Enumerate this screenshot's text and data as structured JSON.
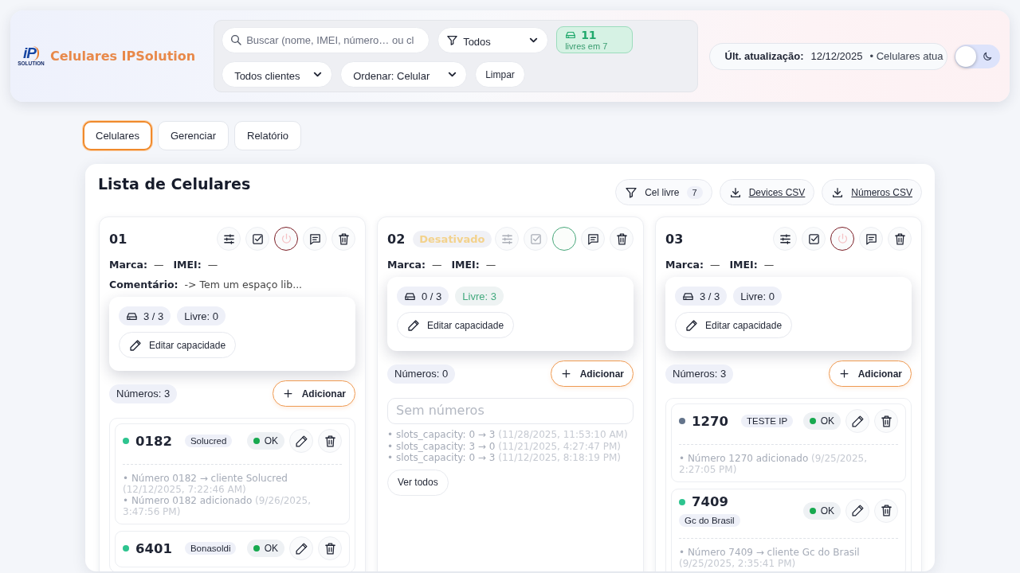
{
  "header": {
    "logo": {
      "mark": "iP",
      "caption": "SOLUTION"
    },
    "brand": "Celulares IPSolution",
    "search": {
      "placeholder": "Buscar (nome, IMEI, número… ou cl"
    },
    "status_select": {
      "value": "Todos"
    },
    "free_badge": {
      "count": "11",
      "caption": "livres em 7"
    },
    "client_select": {
      "value": "Todos clientes"
    },
    "order_select": {
      "value": "Ordenar: Celular"
    },
    "clear_button": "Limpar",
    "update": {
      "label": "Últ. atualização:",
      "date": "12/12/2025",
      "note": "• Celulares atua"
    },
    "dark_mode": {
      "on": false
    }
  },
  "tabs": [
    {
      "label": "Celulares",
      "selected": true
    },
    {
      "label": "Gerenciar",
      "selected": false
    },
    {
      "label": "Relatório",
      "selected": false
    }
  ],
  "panel": {
    "title": "Lista de Celulares",
    "actions": [
      {
        "kind": "filter",
        "label": "Cel livre",
        "count": "7"
      },
      {
        "kind": "download",
        "label": "Devices CSV"
      },
      {
        "kind": "download",
        "label": "Números CSV"
      }
    ]
  },
  "devices": [
    {
      "name": "01",
      "active": true,
      "fields": [
        {
          "label": "Marca:",
          "value": "—"
        },
        {
          "label": "IMEI:",
          "value": "—"
        }
      ],
      "comment": {
        "label": "Comentário:",
        "value": "-> Tem um espaço lib..."
      },
      "capacity": {
        "used": "3 / 3",
        "free": "Livre: 0",
        "has_free": false,
        "edit": "Editar capacidade"
      },
      "numbers_count": "Números: 3",
      "add": "Adicionar",
      "numbers": [
        {
          "number": "0182",
          "color": "#2ec48f",
          "client": "Solucred",
          "status": "OK",
          "history": [
            {
              "text": "• Número 0182 → cliente Solucred",
              "time": "(12/12/2025, 7:22:46 AM)"
            },
            {
              "text": "• Número 0182 adicionado",
              "time": "(9/26/2025, 3:47:56 PM)"
            }
          ]
        },
        {
          "number": "6401",
          "color": "#2ec48f",
          "client": "Bonasoldi",
          "status": "OK"
        }
      ]
    },
    {
      "name": "02",
      "active": false,
      "badge": "Desativado",
      "fields": [
        {
          "label": "Marca:",
          "value": "—"
        },
        {
          "label": "IMEI:",
          "value": "—"
        }
      ],
      "capacity": {
        "used": "0 / 3",
        "free": "Livre: 3",
        "has_free": true,
        "edit": "Editar capacidade"
      },
      "numbers_count": "Números: 0",
      "add": "Adicionar",
      "empty": "Sem números",
      "history": [
        {
          "text": "• slots_capacity: 0 → 3",
          "time": "(11/28/2025, 11:53:10 AM)"
        },
        {
          "text": "• slots_capacity: 3 → 0",
          "time": "(11/21/2025, 4:27:47 PM)"
        },
        {
          "text": "• slots_capacity: 0 → 3",
          "time": "(11/12/2025, 8:18:19 PM)"
        }
      ],
      "see_all": "Ver todos"
    },
    {
      "name": "03",
      "active": true,
      "fields": [
        {
          "label": "Marca:",
          "value": "—"
        },
        {
          "label": "IMEI:",
          "value": "—"
        }
      ],
      "capacity": {
        "used": "3 / 3",
        "free": "Livre: 0",
        "has_free": false,
        "edit": "Editar capacidade"
      },
      "numbers_count": "Números: 3",
      "add": "Adicionar",
      "numbers": [
        {
          "number": "1270",
          "color": "#64748b",
          "client": "TESTE IP",
          "status": "OK",
          "history": [
            {
              "text": "• Número 1270 adicionado",
              "time": "(9/25/2025, 2:27:05 PM)"
            }
          ]
        },
        {
          "number": "7409",
          "color": "#2ec48f",
          "client": "Gc do Brasil",
          "status": "OK",
          "history": [
            {
              "text": "• Número 7409 → cliente Gc do Brasil",
              "time": "(9/25/2025, 2:35:41 PM)"
            }
          ]
        }
      ]
    }
  ]
}
